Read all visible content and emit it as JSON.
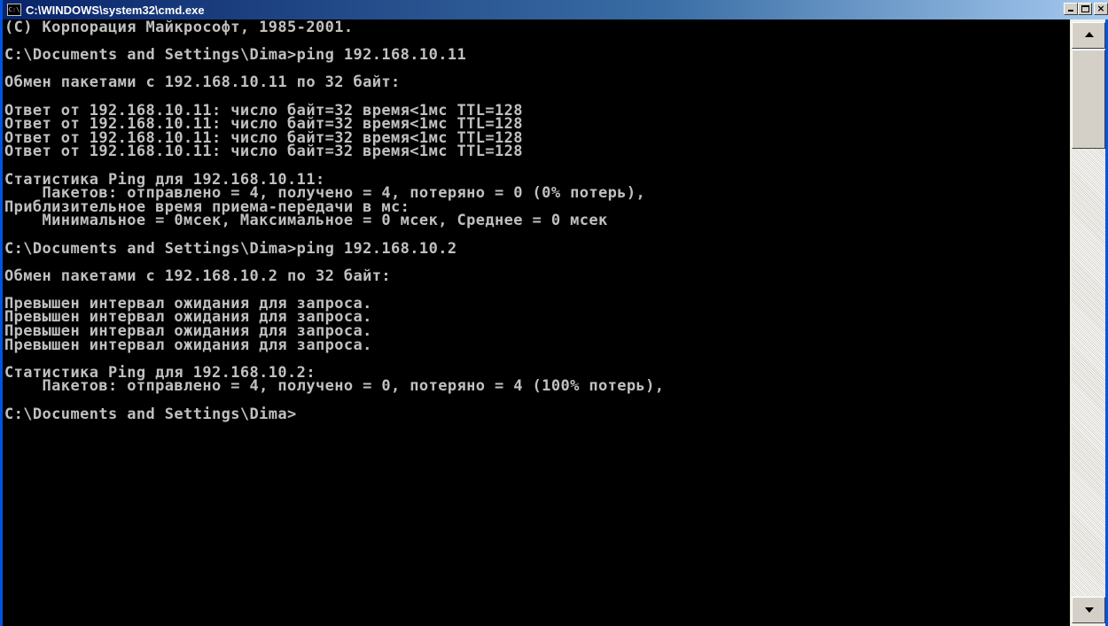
{
  "window": {
    "title": "C:\\WINDOWS\\system32\\cmd.exe",
    "icon_label": "C:\\",
    "icon": "cmd-icon",
    "colors": {
      "titlebar_start": "#0a246a",
      "titlebar_end": "#a6caf0",
      "console_bg": "#000000",
      "console_fg": "#c0c0c0"
    }
  },
  "controls": {
    "minimize": "minimize-icon",
    "maximize": "maximize-icon",
    "close": "close-icon",
    "close_glyph": "×"
  },
  "console": {
    "lines": [
      "(С) Корпорация Майкрософт, 1985-2001.",
      "",
      "C:\\Documents and Settings\\Dima>ping 192.168.10.11",
      "",
      "Обмен пакетами с 192.168.10.11 по 32 байт:",
      "",
      "Ответ от 192.168.10.11: число байт=32 время<1мс TTL=128",
      "Ответ от 192.168.10.11: число байт=32 время<1мс TTL=128",
      "Ответ от 192.168.10.11: число байт=32 время<1мс TTL=128",
      "Ответ от 192.168.10.11: число байт=32 время<1мс TTL=128",
      "",
      "Статистика Ping для 192.168.10.11:",
      "    Пакетов: отправлено = 4, получено = 4, потеряно = 0 (0% потерь),",
      "Приблизительное время приема-передачи в мс:",
      "    Минимальное = 0мсек, Максимальное = 0 мсек, Среднее = 0 мсек",
      "",
      "C:\\Documents and Settings\\Dima>ping 192.168.10.2",
      "",
      "Обмен пакетами с 192.168.10.2 по 32 байт:",
      "",
      "Превышен интервал ожидания для запроса.",
      "Превышен интервал ожидания для запроса.",
      "Превышен интервал ожидания для запроса.",
      "Превышен интервал ожидания для запроса.",
      "",
      "Статистика Ping для 192.168.10.2:",
      "    Пакетов: отправлено = 4, получено = 0, потеряно = 4 (100% потерь),",
      "",
      "C:\\Documents and Settings\\Dima>"
    ]
  },
  "scrollbar": {
    "up_icon": "scroll-up-arrow-icon",
    "down_icon": "scroll-down-arrow-icon"
  }
}
